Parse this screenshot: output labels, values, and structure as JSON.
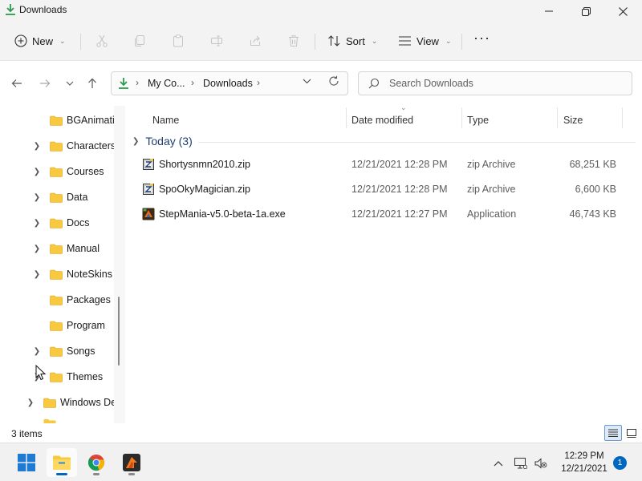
{
  "window": {
    "title": "Downloads",
    "controls": {
      "minimize": "minimize",
      "maximize": "maximize",
      "close": "close"
    }
  },
  "toolbar": {
    "new_label": "New",
    "sort_label": "Sort",
    "view_label": "View",
    "more_label": "···",
    "icons": [
      "cut-icon",
      "copy-icon",
      "paste-icon",
      "rename-icon",
      "share-icon",
      "delete-icon"
    ]
  },
  "address": {
    "crumbs": [
      "My Co...",
      "Downloads"
    ],
    "search_placeholder": "Search Downloads"
  },
  "nav_tree": [
    {
      "label": "BGAnimati",
      "expandable": false
    },
    {
      "label": "Characters",
      "expandable": true
    },
    {
      "label": "Courses",
      "expandable": true
    },
    {
      "label": "Data",
      "expandable": true
    },
    {
      "label": "Docs",
      "expandable": true
    },
    {
      "label": "Manual",
      "expandable": true
    },
    {
      "label": "NoteSkins",
      "expandable": true
    },
    {
      "label": "Packages",
      "expandable": false
    },
    {
      "label": "Program",
      "expandable": false
    },
    {
      "label": "Songs",
      "expandable": true
    },
    {
      "label": "Themes",
      "expandable": true
    },
    {
      "label": "Windows De",
      "expandable": true
    }
  ],
  "columns": {
    "name": "Name",
    "date": "Date modified",
    "type": "Type",
    "size": "Size"
  },
  "group": {
    "label": "Today (3)"
  },
  "files": [
    {
      "name": "Shortysnmn2010.zip",
      "date": "12/21/2021 12:28 PM",
      "type": "zip Archive",
      "size": "68,251 KB",
      "icon": "zip-file-icon"
    },
    {
      "name": "SpoOkyMagician.zip",
      "date": "12/21/2021 12:28 PM",
      "type": "zip Archive",
      "size": "6,600 KB",
      "icon": "zip-file-icon"
    },
    {
      "name": "StepMania-v5.0-beta-1a.exe",
      "date": "12/21/2021 12:27 PM",
      "type": "Application",
      "size": "46,743 KB",
      "icon": "stepmania-app-icon"
    }
  ],
  "status": {
    "item_count": "3 items"
  },
  "taskbar": {
    "apps": [
      "start-icon",
      "file-explorer-icon",
      "chrome-icon",
      "stepmania-icon"
    ],
    "clock_time": "12:29 PM",
    "clock_date": "12/21/2021",
    "notification_count": "1"
  },
  "colors": {
    "accent": "#0067c0",
    "folder": "#f8c93f",
    "download_green": "#2b9a4a"
  }
}
